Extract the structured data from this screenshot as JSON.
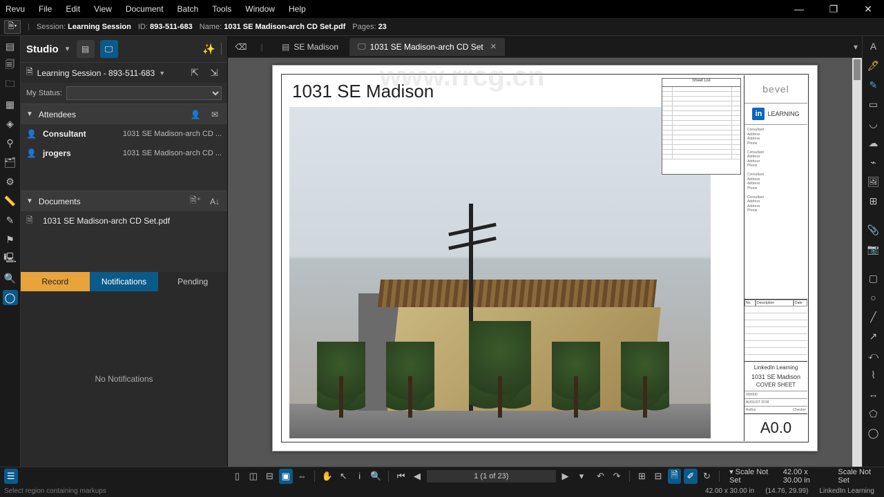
{
  "menu": {
    "items": [
      "Revu",
      "File",
      "Edit",
      "View",
      "Document",
      "Batch",
      "Tools",
      "Window",
      "Help"
    ]
  },
  "window_controls": {
    "min": "—",
    "max": "❐",
    "close": "✕"
  },
  "session": {
    "label_session": "Session:",
    "session": "Learning Session",
    "label_id": "ID:",
    "id": "893-511-683",
    "label_name": "Name:",
    "name": "1031 SE Madison-arch CD Set.pdf",
    "label_pages": "Pages:",
    "pages": "23"
  },
  "studio": {
    "title": "Studio",
    "session_name": "Learning Session - 893-511-683",
    "status_label": "My Status:",
    "attendees_label": "Attendees",
    "attendees": [
      {
        "name": "Consultant",
        "doc": "1031 SE Madison-arch CD ..."
      },
      {
        "name": "jrogers",
        "doc": "1031 SE Madison-arch CD ..."
      }
    ],
    "documents_label": "Documents",
    "documents": [
      {
        "name": "1031 SE Madison-arch CD Set.pdf"
      }
    ],
    "tabs": {
      "record": "Record",
      "notifications": "Notifications",
      "pending": "Pending"
    },
    "no_notifications": "No Notifications"
  },
  "doctabs": [
    {
      "label": "SE Madison",
      "active": false,
      "closable": false
    },
    {
      "label": "1031 SE Madison-arch CD Set",
      "active": true,
      "closable": true
    }
  ],
  "page": {
    "title": "1031 SE Madison",
    "titleblock": {
      "logo": "bevel",
      "linkedin": "LEARNING",
      "client": "LinkedIn Learning",
      "project": "1031 SE Madison",
      "sheet_title": "COVER SHEET",
      "proj_no": "000000",
      "date": "AUGUST 2018",
      "author": "Author",
      "checker": "Checker",
      "sheet_no": "A0.0",
      "rev_headers": [
        "No.",
        "Description",
        "Date"
      ]
    },
    "sheetlist_title": "Sheet List"
  },
  "bottom": {
    "page_indicator": "1 (1 of 23)",
    "scale_label": "Scale Not Set",
    "dims": "42.00 x 30.00 in",
    "scale_label2": "Scale Not Set",
    "dims2": "42.00 x 30.00 in"
  },
  "status": {
    "hint": "Select region containing markups",
    "coords": "(14.76, 29.99)",
    "brand": "LinkedIn Learning"
  },
  "watermark_url": "www.rrcg.cn"
}
